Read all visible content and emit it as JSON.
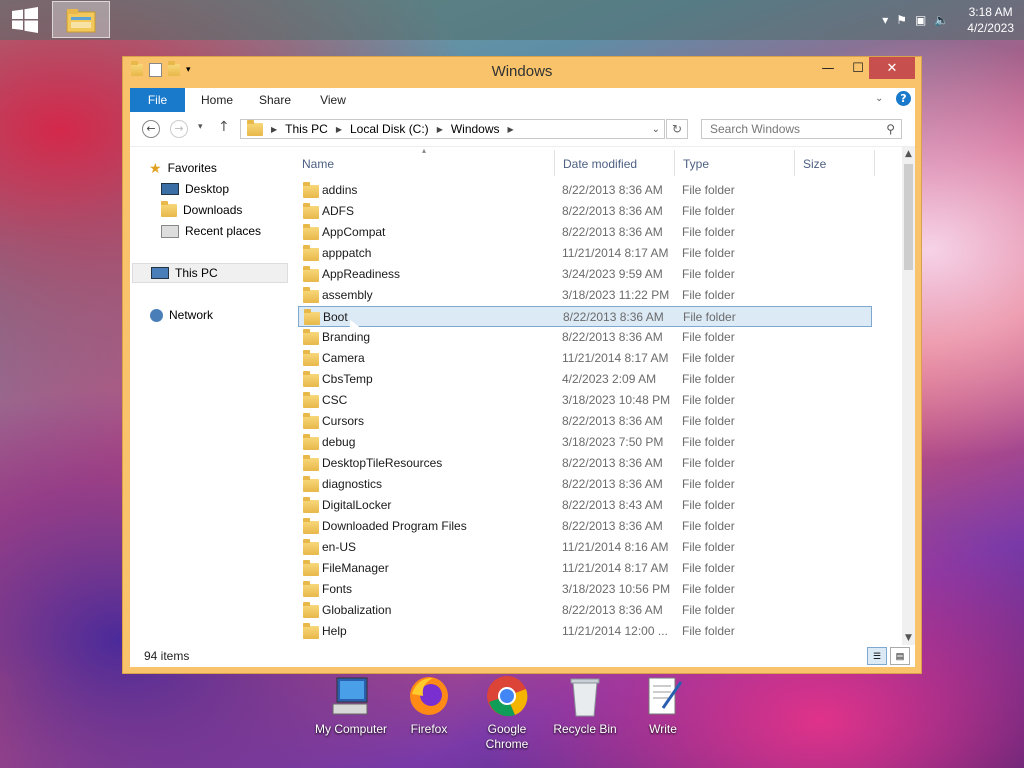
{
  "taskbar": {
    "clock_time": "3:18 AM",
    "clock_date": "4/2/2023"
  },
  "window": {
    "title": "Windows",
    "ribbon_tabs": [
      "File",
      "Home",
      "Share",
      "View"
    ],
    "breadcrumb": [
      "This PC",
      "Local Disk (C:)",
      "Windows"
    ],
    "search_placeholder": "Search Windows",
    "columns": [
      "Name",
      "Date modified",
      "Type",
      "Size"
    ],
    "status": "94 items"
  },
  "nav_pane": {
    "favorites": "Favorites",
    "desktop": "Desktop",
    "downloads": "Downloads",
    "recent": "Recent places",
    "this_pc": "This PC",
    "network": "Network"
  },
  "files": [
    {
      "name": "addins",
      "date": "8/22/2013 8:36 AM",
      "type": "File folder"
    },
    {
      "name": "ADFS",
      "date": "8/22/2013 8:36 AM",
      "type": "File folder"
    },
    {
      "name": "AppCompat",
      "date": "8/22/2013 8:36 AM",
      "type": "File folder"
    },
    {
      "name": "apppatch",
      "date": "11/21/2014 8:17 AM",
      "type": "File folder"
    },
    {
      "name": "AppReadiness",
      "date": "3/24/2023 9:59 AM",
      "type": "File folder"
    },
    {
      "name": "assembly",
      "date": "3/18/2023 11:22 PM",
      "type": "File folder"
    },
    {
      "name": "Boot",
      "date": "8/22/2013 8:36 AM",
      "type": "File folder"
    },
    {
      "name": "Branding",
      "date": "8/22/2013 8:36 AM",
      "type": "File folder"
    },
    {
      "name": "Camera",
      "date": "11/21/2014 8:17 AM",
      "type": "File folder"
    },
    {
      "name": "CbsTemp",
      "date": "4/2/2023 2:09 AM",
      "type": "File folder"
    },
    {
      "name": "CSC",
      "date": "3/18/2023 10:48 PM",
      "type": "File folder"
    },
    {
      "name": "Cursors",
      "date": "8/22/2013 8:36 AM",
      "type": "File folder"
    },
    {
      "name": "debug",
      "date": "3/18/2023 7:50 PM",
      "type": "File folder"
    },
    {
      "name": "DesktopTileResources",
      "date": "8/22/2013 8:36 AM",
      "type": "File folder"
    },
    {
      "name": "diagnostics",
      "date": "8/22/2013 8:36 AM",
      "type": "File folder"
    },
    {
      "name": "DigitalLocker",
      "date": "8/22/2013 8:43 AM",
      "type": "File folder"
    },
    {
      "name": "Downloaded Program Files",
      "date": "8/22/2013 8:36 AM",
      "type": "File folder"
    },
    {
      "name": "en-US",
      "date": "11/21/2014 8:16 AM",
      "type": "File folder"
    },
    {
      "name": "FileManager",
      "date": "11/21/2014 8:17 AM",
      "type": "File folder"
    },
    {
      "name": "Fonts",
      "date": "3/18/2023 10:56 PM",
      "type": "File folder"
    },
    {
      "name": "Globalization",
      "date": "8/22/2013 8:36 AM",
      "type": "File folder"
    },
    {
      "name": "Help",
      "date": "11/21/2014 12:00 ...",
      "type": "File folder"
    }
  ],
  "selected_file": "Boot",
  "desktop_icons": [
    "My Computer",
    "Firefox",
    "Google Chrome",
    "Recycle Bin",
    "Write"
  ]
}
